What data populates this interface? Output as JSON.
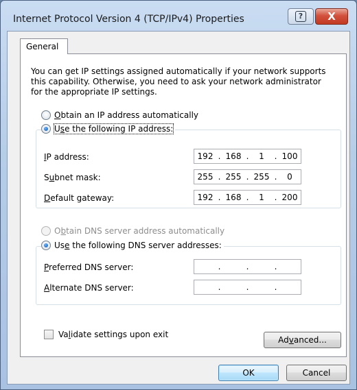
{
  "window": {
    "title": "Internet Protocol Version 4 (TCP/IPv4) Properties",
    "help_icon": "help-icon",
    "help_glyph": "?",
    "close_icon": "close-icon",
    "close_glyph": "X"
  },
  "tabs": [
    {
      "label": "General",
      "selected": true
    }
  ],
  "description": "You can get IP settings assigned automatically if your network supports this capability. Otherwise, you need to ask your network administrator for the appropriate IP settings.",
  "ip_mode": {
    "auto": {
      "pre": "",
      "key": "O",
      "post": "btain an IP address automatically",
      "selected": false
    },
    "manual": {
      "pre": "U",
      "key": "s",
      "post": "e the following IP address:",
      "selected": true
    }
  },
  "ip_fields": [
    {
      "pre": "",
      "key": "I",
      "post": "P address:",
      "octets": [
        "192",
        "168",
        "1",
        "100"
      ]
    },
    {
      "pre": "S",
      "key": "u",
      "post": "bnet mask:",
      "octets": [
        "255",
        "255",
        "255",
        "0"
      ]
    },
    {
      "pre": "",
      "key": "D",
      "post": "efault gateway:",
      "octets": [
        "192",
        "168",
        "1",
        "200"
      ]
    }
  ],
  "dns_mode": {
    "auto": {
      "pre": "O",
      "key": "b",
      "post": "tain DNS server address automatically",
      "selected": false,
      "disabled": true
    },
    "manual": {
      "pre": "Us",
      "key": "e",
      "post": " the following DNS server addresses:",
      "selected": true
    }
  },
  "dns_fields": [
    {
      "pre": "",
      "key": "P",
      "post": "referred DNS server:",
      "octets": [
        "",
        "",
        "",
        ""
      ]
    },
    {
      "pre": "",
      "key": "A",
      "post": "lternate DNS server:",
      "octets": [
        "",
        "",
        "",
        ""
      ]
    }
  ],
  "validate": {
    "pre": "Va",
    "key": "l",
    "post": "idate settings upon exit",
    "checked": false
  },
  "buttons": {
    "advanced": {
      "pre": "Ad",
      "key": "v",
      "post": "anced..."
    },
    "ok": "OK",
    "cancel": "Cancel"
  },
  "colors": {
    "title_bar": "#b6cde8",
    "close_button": "#c23a22",
    "radio_checked": "#0b4fa8",
    "disabled_text": "#8d8d8d",
    "default_button_border": "#3c7fb1"
  }
}
